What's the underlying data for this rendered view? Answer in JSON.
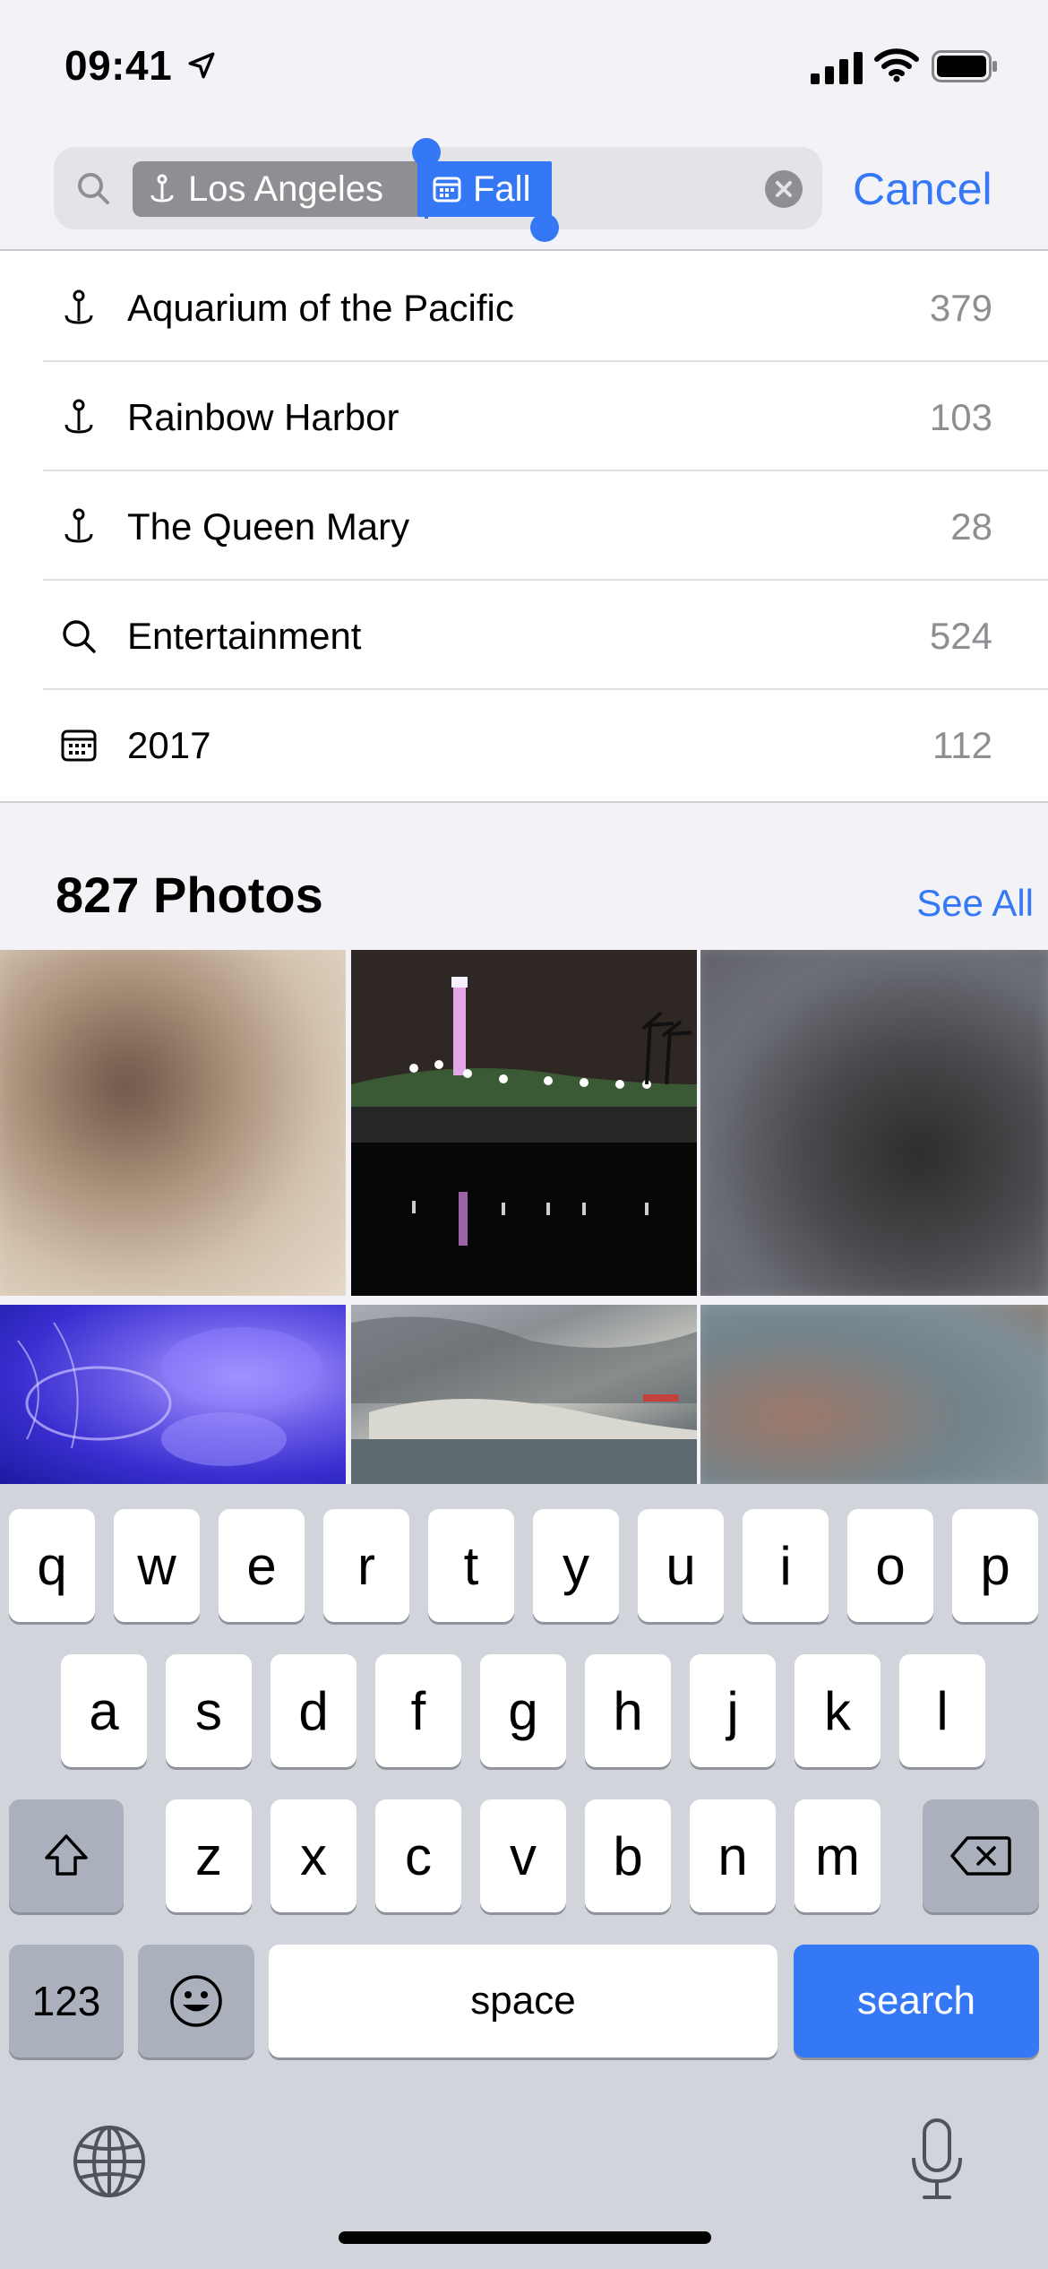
{
  "status_bar": {
    "time": "09:41",
    "icons": [
      "location-arrow-icon",
      "signal-icon",
      "wifi-icon",
      "battery-icon"
    ]
  },
  "search": {
    "tokens": [
      {
        "label": "Los Angeles",
        "icon": "place-icon"
      },
      {
        "label": "Fall",
        "icon": "calendar-icon"
      }
    ],
    "cancel_label": "Cancel"
  },
  "suggestions": [
    {
      "icon": "place-icon",
      "label": "Aquarium of the Pacific",
      "count": "379"
    },
    {
      "icon": "place-icon",
      "label": "Rainbow Harbor",
      "count": "103"
    },
    {
      "icon": "place-icon",
      "label": "The Queen Mary",
      "count": "28"
    },
    {
      "icon": "search-icon",
      "label": "Entertainment",
      "count": "524"
    },
    {
      "icon": "calendar-icon",
      "label": "2017",
      "count": "112"
    }
  ],
  "photos": {
    "title": "827 Photos",
    "see_all_label": "See All"
  },
  "keyboard": {
    "row1": [
      "q",
      "w",
      "e",
      "r",
      "t",
      "y",
      "u",
      "i",
      "o",
      "p"
    ],
    "row2": [
      "a",
      "s",
      "d",
      "f",
      "g",
      "h",
      "j",
      "k",
      "l"
    ],
    "row3": [
      "z",
      "x",
      "c",
      "v",
      "b",
      "n",
      "m"
    ],
    "numbers_label": "123",
    "space_label": "space",
    "search_label": "search"
  },
  "colors": {
    "accent": "#3478f6",
    "token_gray": "#8e8e93",
    "keyboard_bg": "#d1d4da"
  }
}
